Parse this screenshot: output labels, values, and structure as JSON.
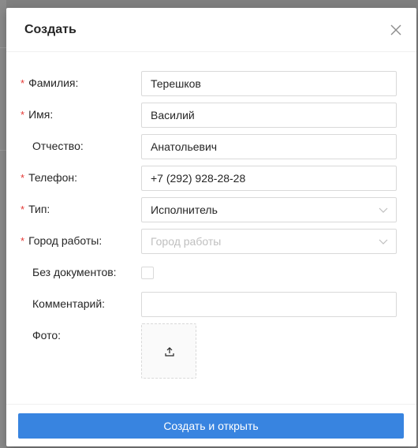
{
  "modal": {
    "title": "Создать",
    "close_icon": "close-icon"
  },
  "form": {
    "last_name": {
      "label": "Фамилия:",
      "required": true,
      "value": "Терешков"
    },
    "first_name": {
      "label": "Имя:",
      "required": true,
      "value": "Василий"
    },
    "middle_name": {
      "label": "Отчество:",
      "required": false,
      "value": "Анатольевич"
    },
    "phone": {
      "label": "Телефон:",
      "required": true,
      "value": "+7 (292) 928-28-28"
    },
    "type": {
      "label": "Тип:",
      "required": true,
      "value": "Исполнитель",
      "icon": "chevron-down-icon"
    },
    "city": {
      "label": "Город работы:",
      "required": true,
      "value": "",
      "placeholder": "Город работы",
      "icon": "chevron-down-icon"
    },
    "no_documents": {
      "label": "Без документов:",
      "checked": false
    },
    "comment": {
      "label": "Комментарий:",
      "value": ""
    },
    "photo": {
      "label": "Фото:",
      "icon": "upload-icon"
    }
  },
  "footer": {
    "submit_label": "Создать и открыть"
  },
  "required_marker": "*",
  "colors": {
    "primary": "#3884e0",
    "required": "#e53935",
    "border": "#d9d9d9",
    "placeholder": "#bfbfbf"
  }
}
